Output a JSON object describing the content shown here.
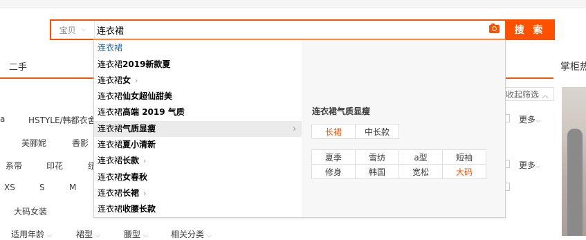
{
  "search": {
    "scope_label": "宝贝",
    "query": "连衣裙",
    "button_label": "搜 索"
  },
  "page": {
    "secondhand_tab": "二手",
    "right_panel_title": "掌柜热",
    "collapse_filter": "收起筛选",
    "more_1": "更多",
    "more_2": "更多",
    "filters": {
      "row1": [
        "a",
        "HSTYLE/韩都衣舍"
      ],
      "row2": [
        "芙郦妮",
        "香影"
      ],
      "row3": [
        "系带",
        "印花",
        "纽"
      ],
      "row4": [
        "XS",
        "S",
        "M"
      ],
      "row5": [
        "大码女装"
      ],
      "row6": [
        "适用年龄",
        "裙型",
        "腰型",
        "相关分类"
      ]
    }
  },
  "suggestions": [
    {
      "prefix": "连衣裙",
      "suffix": "",
      "arrow": false
    },
    {
      "prefix": "连衣裙",
      "suffix": "2019新款夏",
      "arrow": false
    },
    {
      "prefix": "连衣裙",
      "suffix": "女",
      "arrow": true
    },
    {
      "prefix": "连衣裙",
      "suffix": "仙女超仙甜美",
      "arrow": false
    },
    {
      "prefix": "连衣裙",
      "suffix": "高端 2019 气质",
      "arrow": false
    },
    {
      "prefix": "连衣裙",
      "suffix": "气质显瘦",
      "arrow": true
    },
    {
      "prefix": "连衣裙",
      "suffix": "夏小清新",
      "arrow": false
    },
    {
      "prefix": "连衣裙",
      "suffix": "长款",
      "arrow": true
    },
    {
      "prefix": "连衣裙",
      "suffix": "女春秋",
      "arrow": false
    },
    {
      "prefix": "连衣裙",
      "suffix": "长裙",
      "arrow": true
    },
    {
      "prefix": "连衣裙",
      "suffix": "收腰长款",
      "arrow": false
    }
  ],
  "detail": {
    "title": "连衣裙气质显瘦",
    "length_tabs": [
      "长裙",
      "中长款"
    ],
    "tags": [
      "夏季",
      "雪纺",
      "a型",
      "短袖",
      "修身",
      "韩国",
      "宽松",
      "大码"
    ]
  },
  "colors": {
    "accent": "#ff5000",
    "link": "#1e6bb8"
  }
}
